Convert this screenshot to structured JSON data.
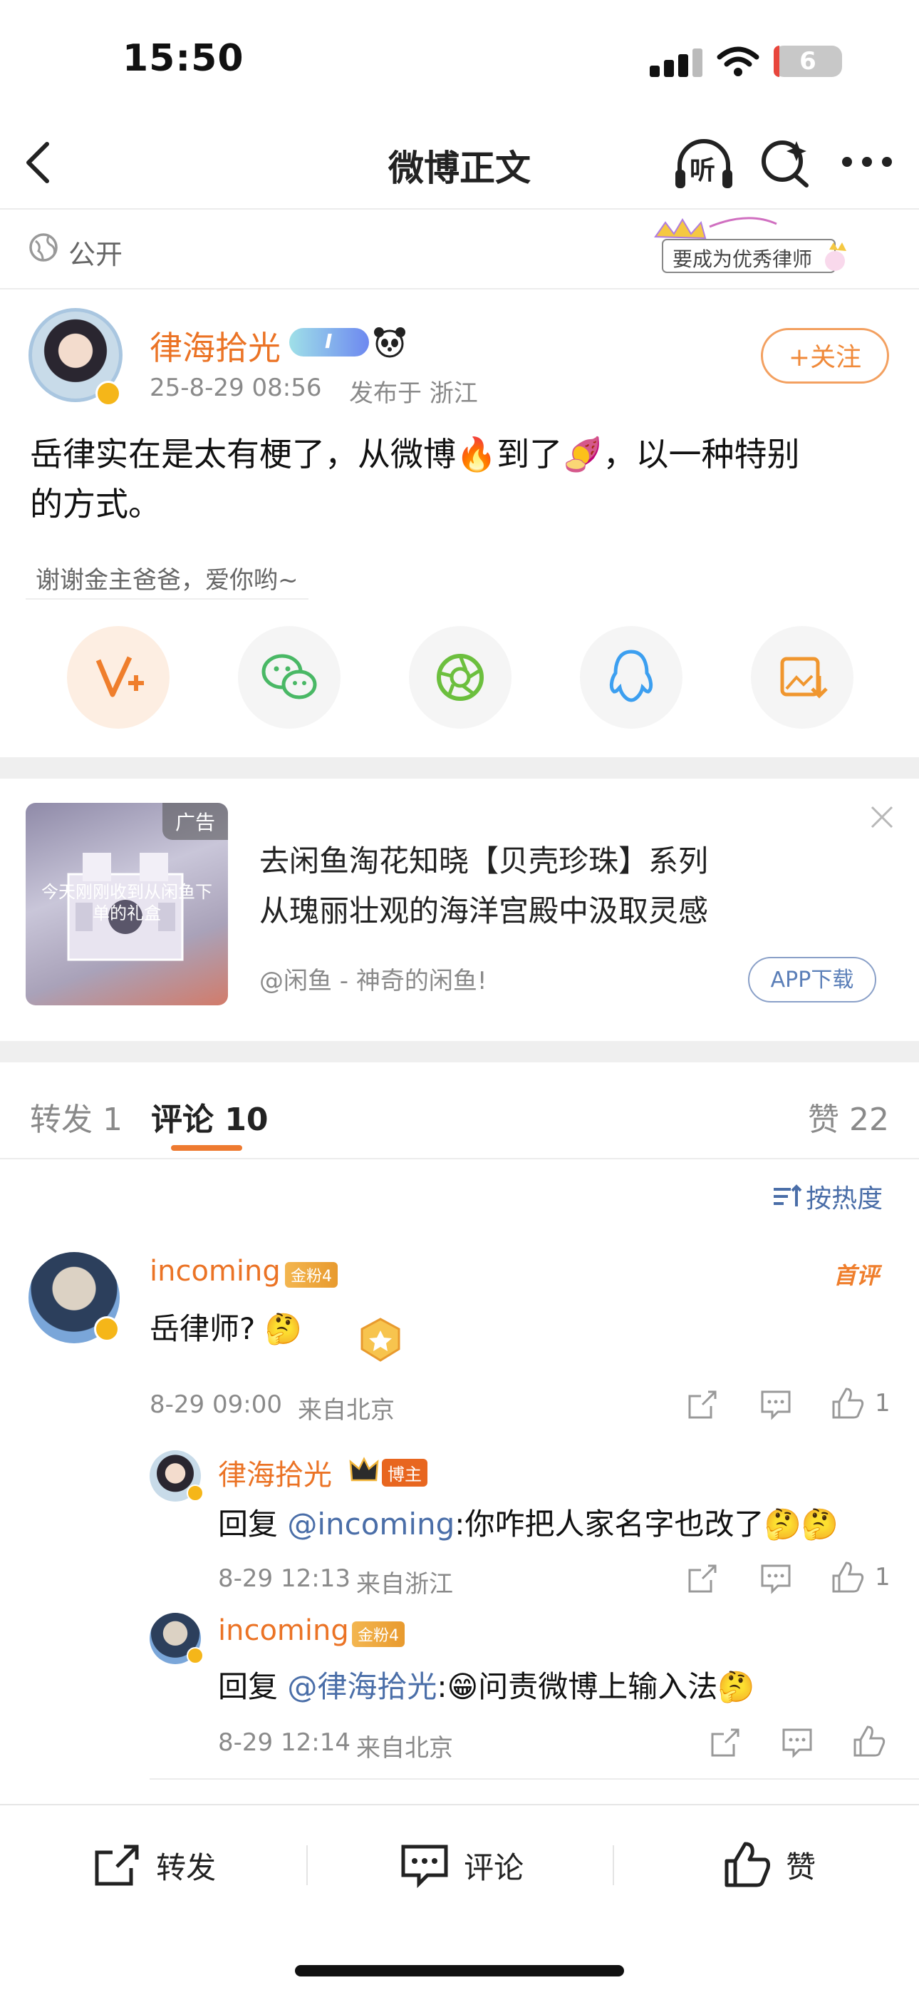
{
  "status_bar": {
    "time": "15:50",
    "battery": "6"
  },
  "nav": {
    "title": "微博正文",
    "listen_label": "听"
  },
  "visibility": {
    "label": "公开",
    "sticker_text": "要成为优秀律师"
  },
  "post": {
    "author": "律海拾光",
    "timestamp": "25-8-29 08:56",
    "location": "发布于 浙江",
    "follow_label": "+关注",
    "text_line1": "岳律实在是太有梗了，从微博🔥到了🍠，以一种特别",
    "text_line2": "的方式。",
    "thanks_text": "谢谢金主爸爸，爱你哟~"
  },
  "ad": {
    "tag": "广告",
    "title_line1": "去闲鱼淘花知晓【贝壳珍珠】系列",
    "title_line2": "从瑰丽壮观的海洋宫殿中汲取灵感",
    "source": "@闲鱼 - 神奇的闲鱼!",
    "button": "APP下载",
    "img_caption": "今天刚刚收到从闲鱼下单的礼盒"
  },
  "tabs": {
    "repost": "转发 1",
    "comments": "评论 10",
    "likes": "赞 22",
    "sort_label": "按热度"
  },
  "comments": [
    {
      "name": "incoming",
      "badge": "金粉4",
      "tag": "首评",
      "text": "岳律师? 🤔",
      "time": "8-29 09:00",
      "loc": "来自北京",
      "likes": "1"
    },
    {
      "name": "律海拾光",
      "badge": "博主",
      "prefix": "回复 ",
      "mention": "@incoming",
      "text": ":你咋把人家名字也改了🤔🤔",
      "time": "8-29 12:13",
      "loc": "来自浙江",
      "likes": "1"
    },
    {
      "name": "incoming",
      "badge": "金粉4",
      "prefix": "回复 ",
      "mention": "@律海拾光",
      "text": ":😁问责微博上输入法🤔",
      "time": "8-29 12:14",
      "loc": "来自北京"
    }
  ],
  "bottom_bar": {
    "repost": "转发",
    "comment": "评论",
    "like": "赞"
  },
  "colors": {
    "accent": "#eb7325",
    "mention": "#4a6ea8",
    "gray_text": "#8a8a8a"
  }
}
